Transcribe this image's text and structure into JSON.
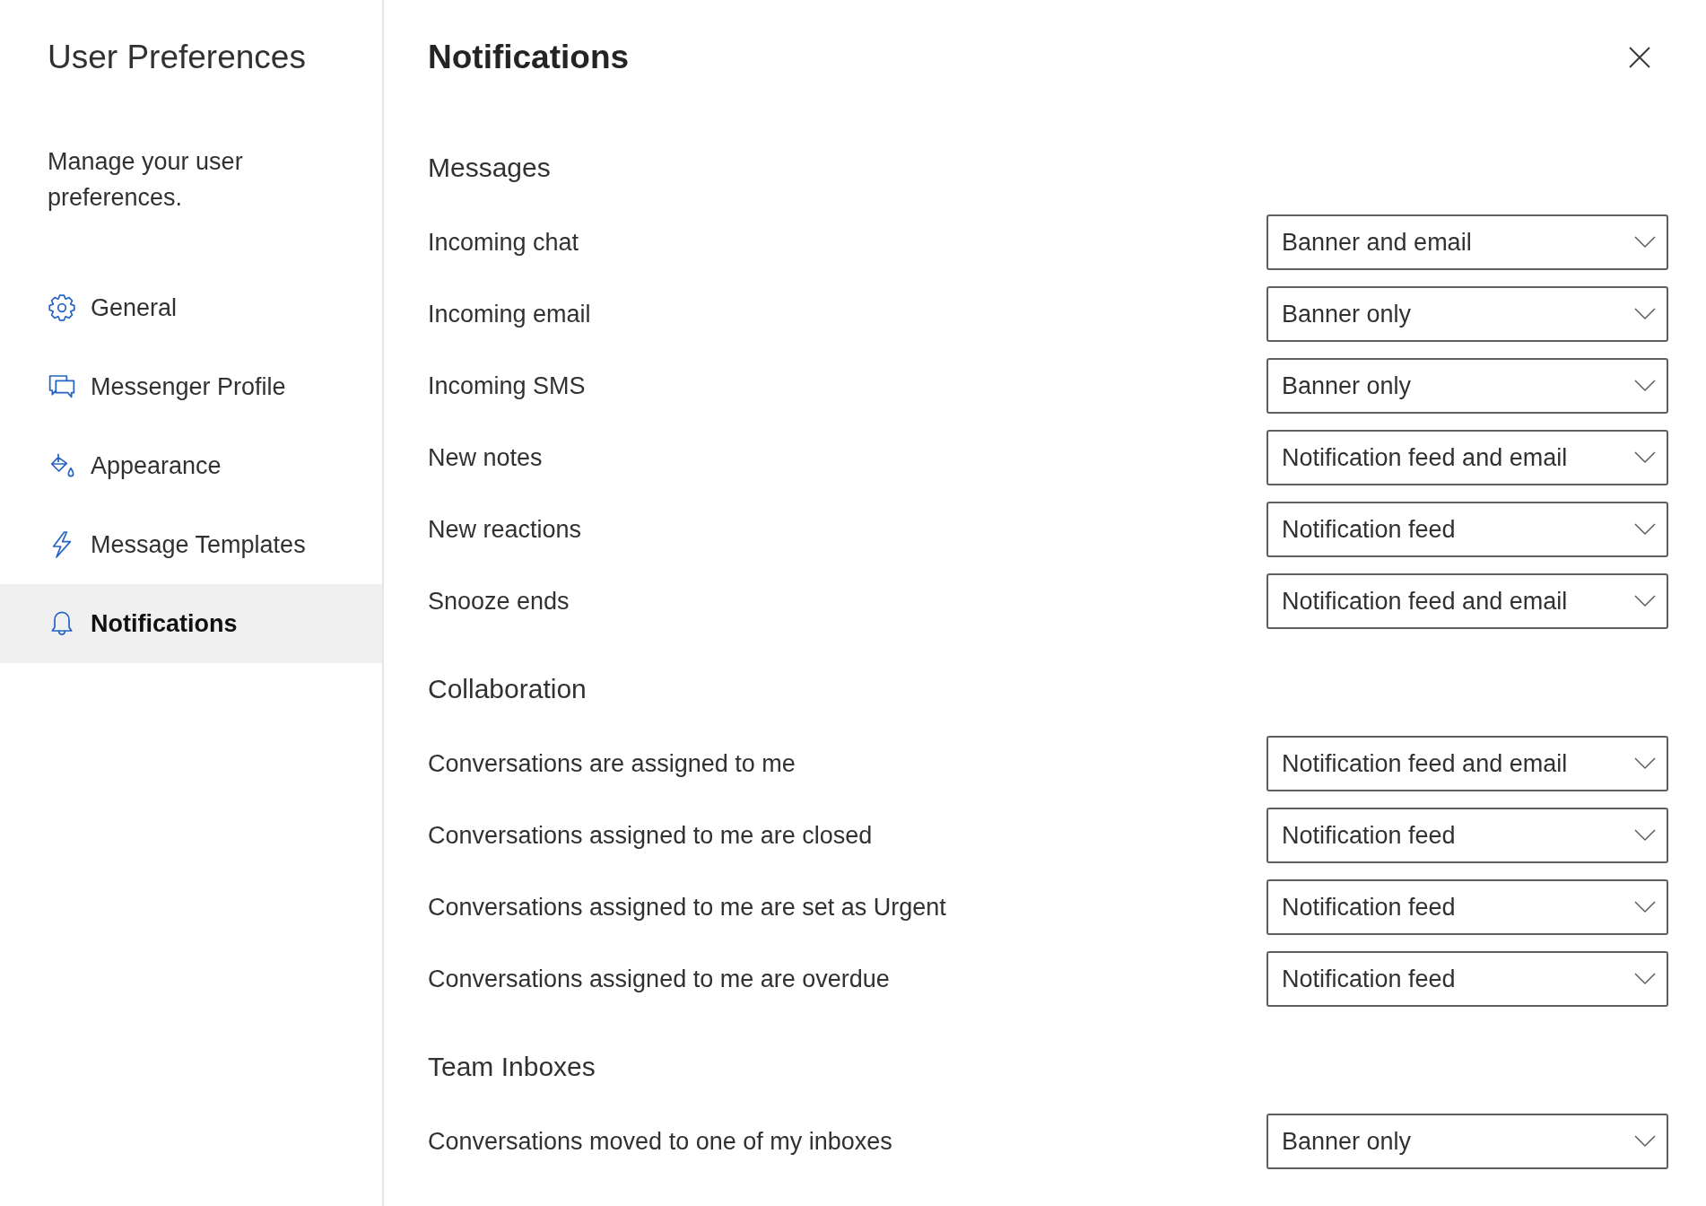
{
  "sidebar": {
    "title": "User Preferences",
    "description": "Manage your user preferences.",
    "items": [
      {
        "label": "General",
        "selected": false
      },
      {
        "label": "Messenger Profile",
        "selected": false
      },
      {
        "label": "Appearance",
        "selected": false
      },
      {
        "label": "Message Templates",
        "selected": false
      },
      {
        "label": "Notifications",
        "selected": true
      }
    ]
  },
  "panel": {
    "title": "Notifications",
    "sections": [
      {
        "heading": "Messages",
        "settings": [
          {
            "label": "Incoming chat",
            "value": "Banner and email"
          },
          {
            "label": "Incoming email",
            "value": "Banner only"
          },
          {
            "label": "Incoming SMS",
            "value": "Banner only"
          },
          {
            "label": "New notes",
            "value": "Notification feed and email"
          },
          {
            "label": "New reactions",
            "value": "Notification feed"
          },
          {
            "label": "Snooze ends",
            "value": "Notification feed and email"
          }
        ]
      },
      {
        "heading": "Collaboration",
        "settings": [
          {
            "label": "Conversations are assigned to me",
            "value": "Notification feed and email"
          },
          {
            "label": "Conversations assigned to me are closed",
            "value": "Notification feed"
          },
          {
            "label": "Conversations assigned to me are set as Urgent",
            "value": "Notification feed"
          },
          {
            "label": "Conversations assigned to me are overdue",
            "value": "Notification feed"
          }
        ]
      },
      {
        "heading": "Team Inboxes",
        "settings": [
          {
            "label": "Conversations moved to one of my inboxes",
            "value": "Banner only"
          }
        ]
      }
    ]
  }
}
